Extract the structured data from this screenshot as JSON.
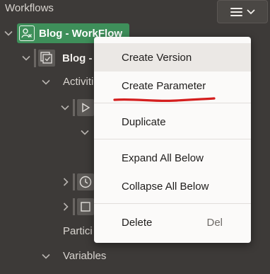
{
  "header": {
    "title": "Workflows",
    "menu_icon": "hamburger-icon",
    "menu_chevron_icon": "chevron-down-icon"
  },
  "tree": {
    "root": {
      "label": "Blog - WorkFlow",
      "icon": "workflow-icon",
      "color": "#3e8f5a"
    },
    "version": {
      "label": "Blog - V",
      "icon": "version-icon"
    },
    "activities_label": "Activiti",
    "participants_label": "Partici",
    "variables_label": "Variables",
    "activity_icons": [
      "play-icon",
      "clock-icon",
      "square-icon"
    ]
  },
  "context_menu": {
    "items": [
      {
        "label": "Create Version",
        "shortcut": "",
        "active": true
      },
      {
        "label": "Create Parameter",
        "shortcut": "",
        "active": false
      },
      {
        "label": "Duplicate",
        "shortcut": "",
        "active": false
      },
      {
        "label": "Expand All Below",
        "shortcut": "",
        "active": false
      },
      {
        "label": "Collapse All Below",
        "shortcut": "",
        "active": false
      },
      {
        "label": "Delete",
        "shortcut": "Del",
        "active": false
      }
    ],
    "annotation_color": "#d41e1e"
  }
}
